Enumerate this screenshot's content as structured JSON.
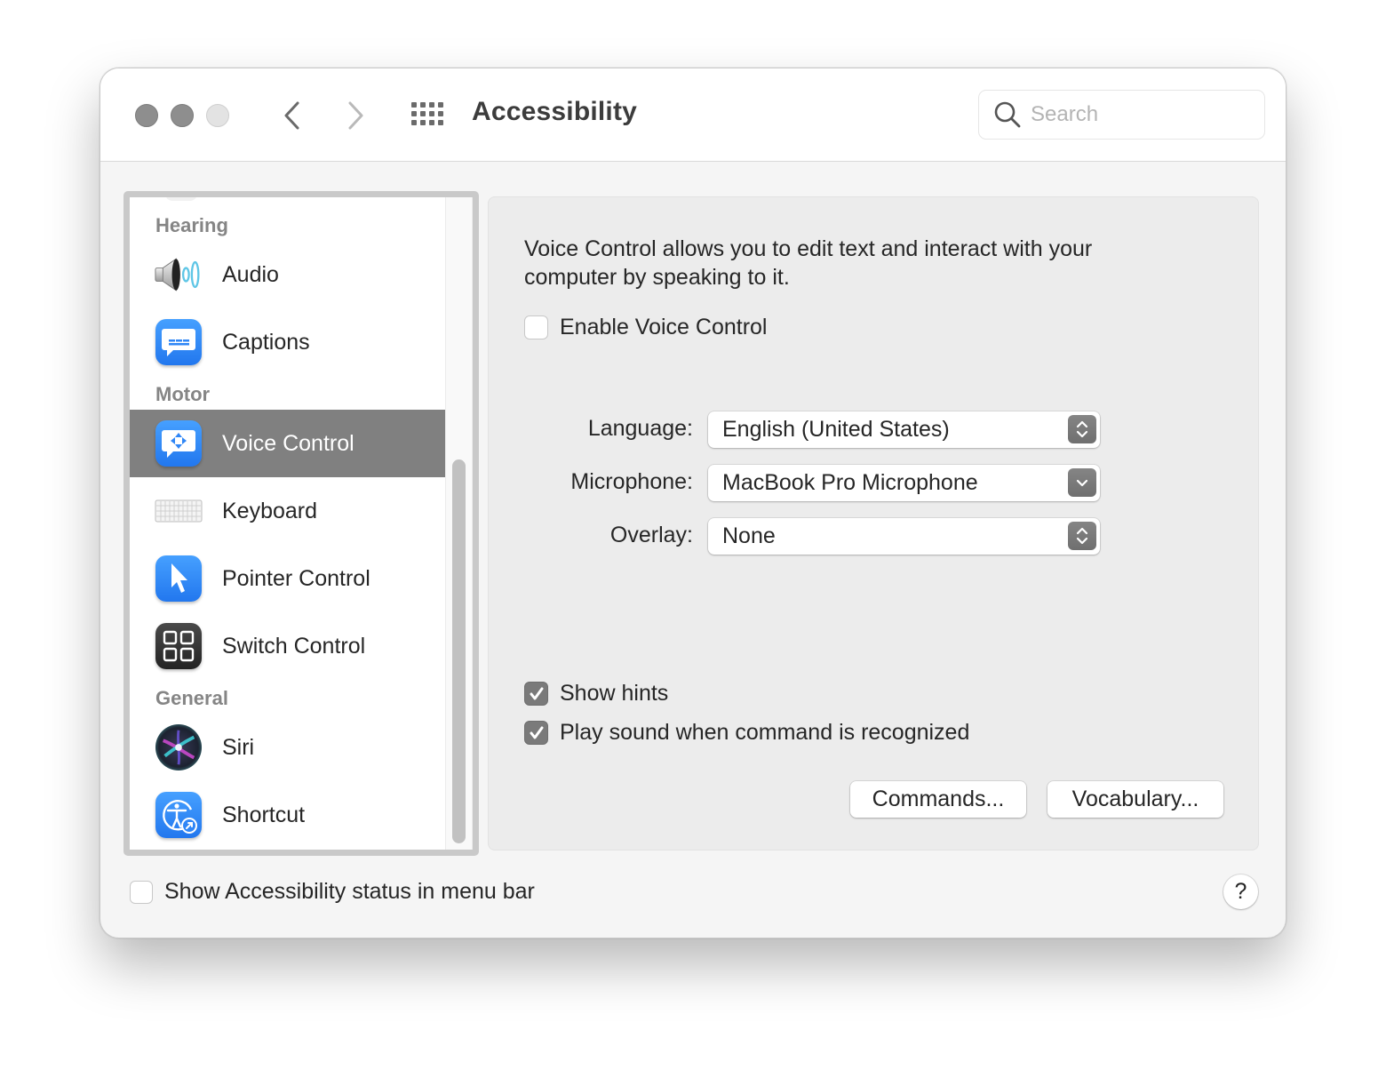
{
  "window": {
    "title": "Accessibility",
    "traffic_lights": [
      "close",
      "minimize",
      "zoom"
    ],
    "nav": {
      "back_icon": "chevron-left-icon",
      "forward_icon": "chevron-right-icon",
      "grid_icon": "show-all-grid-icon"
    },
    "search": {
      "placeholder": "Search",
      "value": "",
      "icon": "search-icon"
    }
  },
  "sidebar": {
    "sections": [
      {
        "header": "Hearing",
        "items": [
          {
            "label": "Audio",
            "icon": "speaker-icon"
          },
          {
            "label": "Captions",
            "icon": "captions-icon"
          }
        ]
      },
      {
        "header": "Motor",
        "items": [
          {
            "label": "Voice Control",
            "icon": "voice-control-icon",
            "selected": true
          },
          {
            "label": "Keyboard",
            "icon": "keyboard-icon"
          },
          {
            "label": "Pointer Control",
            "icon": "pointer-icon"
          },
          {
            "label": "Switch Control",
            "icon": "switch-control-icon"
          }
        ]
      },
      {
        "header": "General",
        "items": [
          {
            "label": "Siri",
            "icon": "siri-icon"
          },
          {
            "label": "Shortcut",
            "icon": "accessibility-shortcut-icon"
          }
        ]
      }
    ]
  },
  "panel": {
    "description": "Voice Control allows you to edit text and interact with your computer by speaking to it.",
    "enable": {
      "label": "Enable Voice Control",
      "checked": false
    },
    "fields": [
      {
        "label": "Language:",
        "value": "English (United States)",
        "arrow": "updown-chevron-icon"
      },
      {
        "label": "Microphone:",
        "value": "MacBook Pro Microphone",
        "arrow": "chevron-down-icon"
      },
      {
        "label": "Overlay:",
        "value": "None",
        "arrow": "updown-chevron-icon"
      }
    ],
    "options": [
      {
        "label": "Show hints",
        "checked": true
      },
      {
        "label": "Play sound when command is recognized",
        "checked": true
      }
    ],
    "buttons": {
      "commands": "Commands...",
      "vocabulary": "Vocabulary..."
    }
  },
  "footer": {
    "status_checkbox": {
      "label": "Show Accessibility status in menu bar",
      "checked": false
    },
    "help": "?"
  },
  "colors": {
    "selection": "#808080",
    "icon_blue": "#2f86f6",
    "checkbox_checked": "#7a7a7a"
  }
}
